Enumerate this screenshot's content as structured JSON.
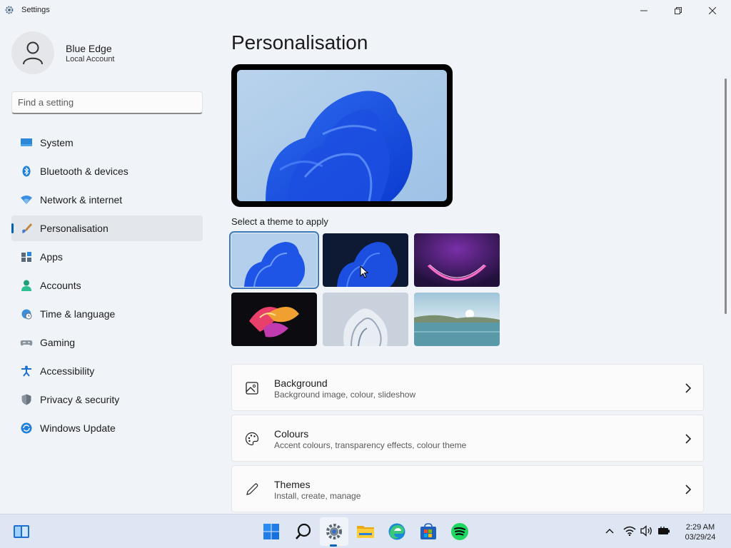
{
  "window": {
    "app_title": "Settings",
    "minimize_icon": "minimize-icon",
    "restore_icon": "restore-icon",
    "close_icon": "close-icon"
  },
  "profile": {
    "name": "Blue Edge",
    "account_type": "Local Account"
  },
  "search": {
    "placeholder": "Find a setting"
  },
  "sidebar": {
    "items": [
      {
        "label": "System",
        "icon": "system-icon",
        "active": false
      },
      {
        "label": "Bluetooth & devices",
        "icon": "bluetooth-icon",
        "active": false
      },
      {
        "label": "Network & internet",
        "icon": "wifi-icon",
        "active": false
      },
      {
        "label": "Personalisation",
        "icon": "brush-icon",
        "active": true
      },
      {
        "label": "Apps",
        "icon": "apps-icon",
        "active": false
      },
      {
        "label": "Accounts",
        "icon": "accounts-icon",
        "active": false
      },
      {
        "label": "Time & language",
        "icon": "globe-clock-icon",
        "active": false
      },
      {
        "label": "Gaming",
        "icon": "gamepad-icon",
        "active": false
      },
      {
        "label": "Accessibility",
        "icon": "accessibility-icon",
        "active": false
      },
      {
        "label": "Privacy & security",
        "icon": "shield-icon",
        "active": false
      },
      {
        "label": "Windows Update",
        "icon": "update-icon",
        "active": false
      }
    ]
  },
  "main": {
    "title": "Personalisation",
    "theme_prompt": "Select a theme to apply",
    "themes": [
      {
        "name": "windows-light-bloom",
        "selected": true
      },
      {
        "name": "windows-dark-bloom",
        "selected": false
      },
      {
        "name": "glow",
        "selected": false
      },
      {
        "name": "captured-motion",
        "selected": false
      },
      {
        "name": "sunrise",
        "selected": false
      },
      {
        "name": "flow",
        "selected": false
      }
    ],
    "cards": [
      {
        "title": "Background",
        "subtitle": "Background image, colour, slideshow",
        "icon": "image-icon"
      },
      {
        "title": "Colours",
        "subtitle": "Accent colours, transparency effects, colour theme",
        "icon": "palette-icon"
      },
      {
        "title": "Themes",
        "subtitle": "Install, create, manage",
        "icon": "pen-icon"
      }
    ]
  },
  "taskbar": {
    "apps": [
      "widgets",
      "start",
      "search",
      "settings",
      "file-explorer",
      "edge",
      "store",
      "spotify"
    ],
    "clock_time": "2:29 AM",
    "clock_date": "03/29/24"
  },
  "colors": {
    "accent": "#0063b1",
    "bloom_blue": "#1a56e8"
  }
}
